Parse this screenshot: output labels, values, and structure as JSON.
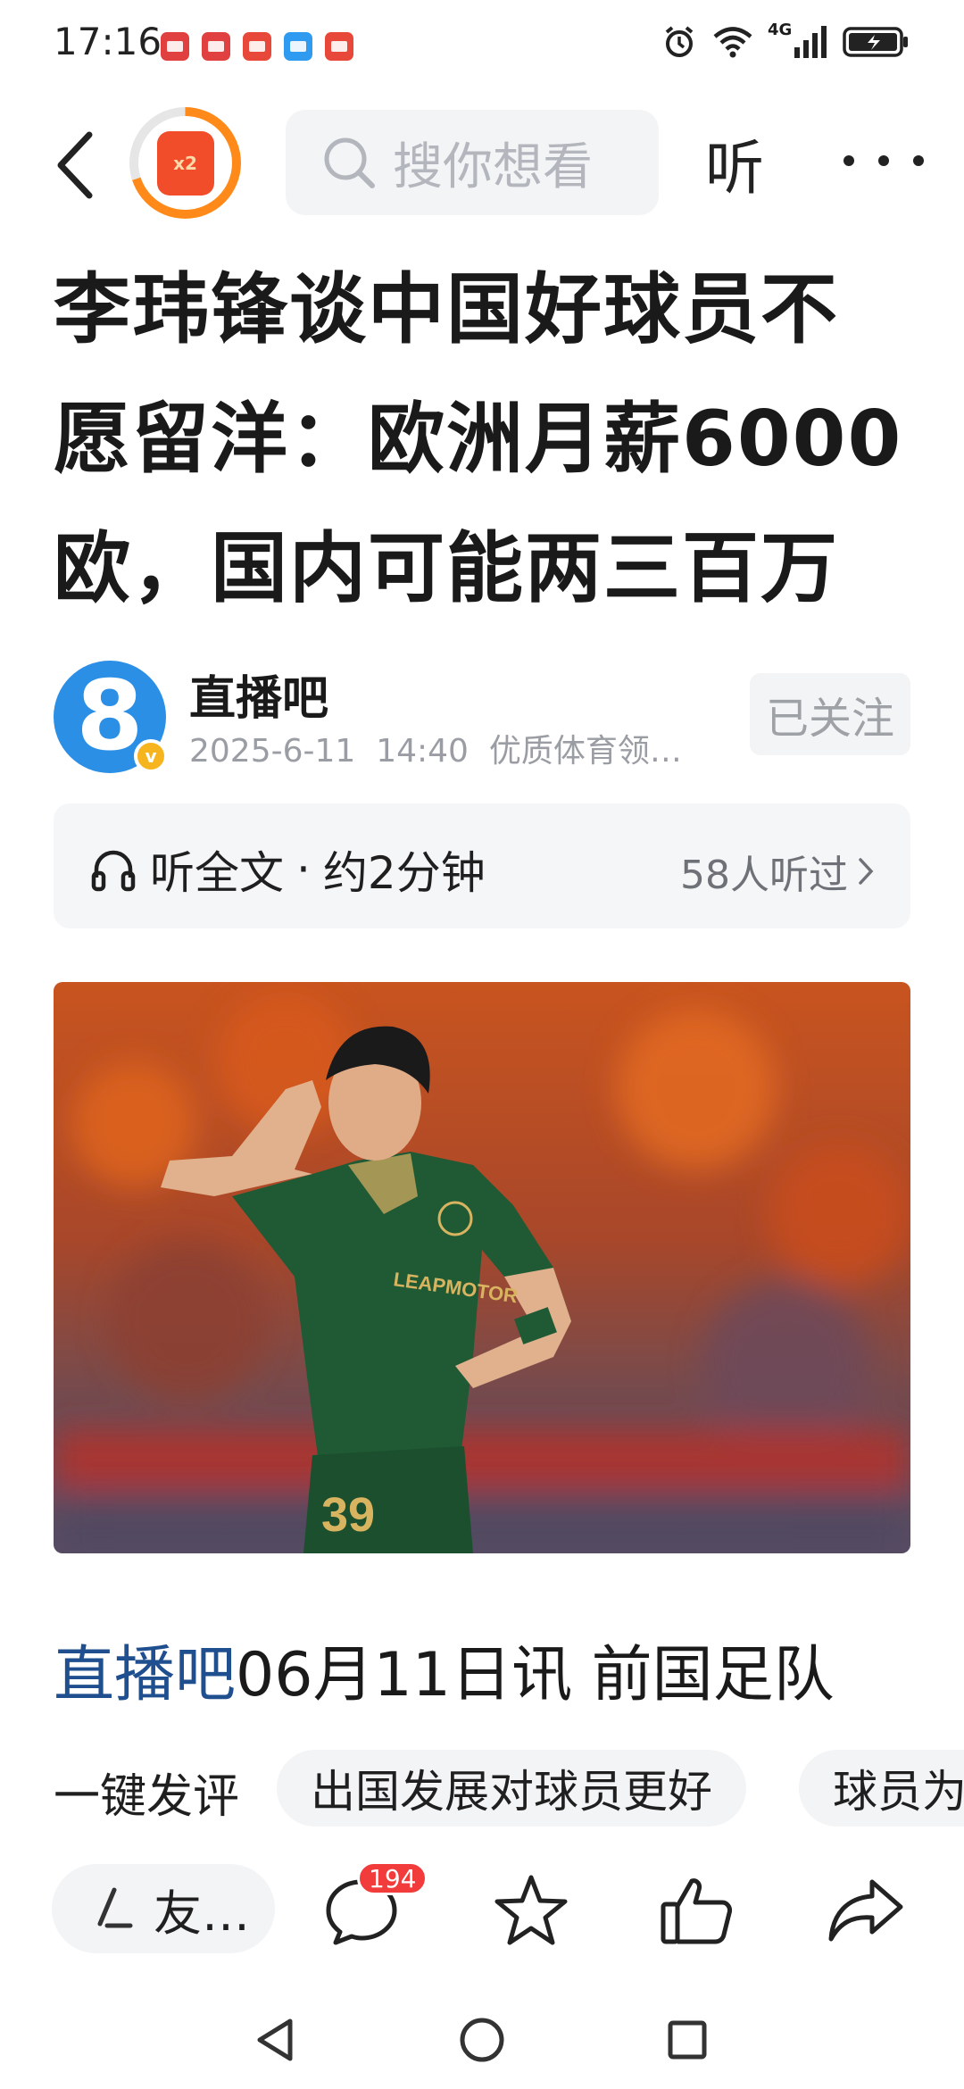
{
  "status_bar": {
    "time": "17:16",
    "network": "4G",
    "notifications": [
      "book-icon",
      "book-icon",
      "huawei-icon",
      "message-icon",
      "huawei-icon"
    ]
  },
  "nav": {
    "redpacket_label": "x2",
    "search_placeholder": "搜你想看",
    "listen_label": "听"
  },
  "article": {
    "title": "李玮锋谈中国好球员不愿留洋：欧洲月薪6000欧，国内可能两三百万",
    "author": {
      "avatar_text": "8",
      "name": "直播吧",
      "date": "2025-6-11",
      "time": "14:40",
      "tagline": "优质体育领…",
      "verified_badge": "v",
      "follow_label": "已关注"
    },
    "listen_bar": {
      "label": "听全文",
      "separator": "·",
      "duration": "约2分钟",
      "listeners": "58人听过"
    },
    "lead_source": "直播吧",
    "lead_text": "06月11日讯 前国足队"
  },
  "quick_comment": {
    "label": "一键发评",
    "chips": [
      "出国发展对球员更好",
      "球员为"
    ]
  },
  "toolbar": {
    "comment_placeholder": "友…",
    "comment_count": "194"
  },
  "colors": {
    "accent_source": "#1f4f8f",
    "badge_red": "#f23b3b",
    "redpacket_orange": "#ff8a1a",
    "avatar_blue": "#2b8fe6"
  }
}
